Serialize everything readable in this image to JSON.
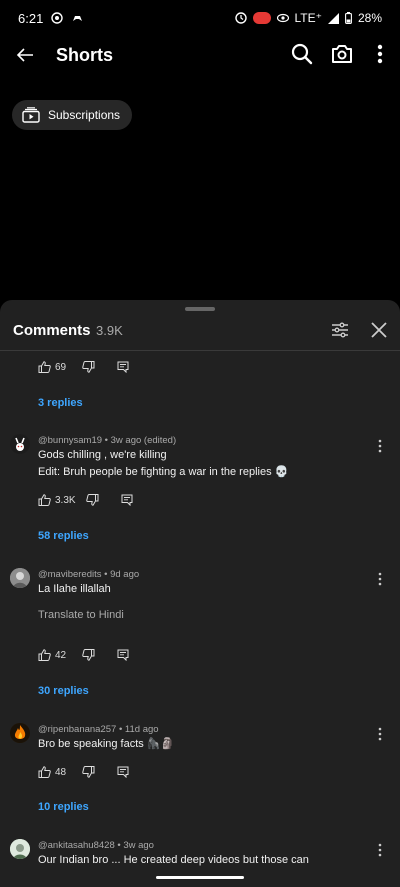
{
  "status_bar": {
    "time": "6:21",
    "network": "LTE⁺",
    "battery": "28%"
  },
  "app_bar": {
    "title": "Shorts"
  },
  "chip": {
    "label": "Subscriptions"
  },
  "comments": {
    "title": "Comments",
    "count": "3.9K",
    "top_partial": {
      "likes": "69",
      "replies": "3 replies"
    },
    "items": [
      {
        "meta": "@bunnysam19 • 3w ago (edited)",
        "line1": "Gods chilling , we're killing",
        "line2": "Edit: Bruh people be fighting a war in the replies 💀",
        "likes": "3.3K",
        "replies": "58 replies"
      },
      {
        "meta": "@maviberedits • 9d ago",
        "line1": "La Ilahe illallah",
        "translate": "Translate to Hindi",
        "likes": "42",
        "replies": "30 replies"
      },
      {
        "meta": "@ripenbanana257 • 11d ago",
        "line1": "Bro be speaking facts 🦍🗿",
        "likes": "48",
        "replies": "10 replies"
      },
      {
        "meta": "@ankitasahu8428 • 3w ago",
        "line1": "Our Indian bro ... He created deep videos but those can"
      }
    ]
  },
  "colors": {
    "accent_link": "#3ea6ff",
    "sheet_bg": "#212121",
    "page_bg": "#000000"
  }
}
